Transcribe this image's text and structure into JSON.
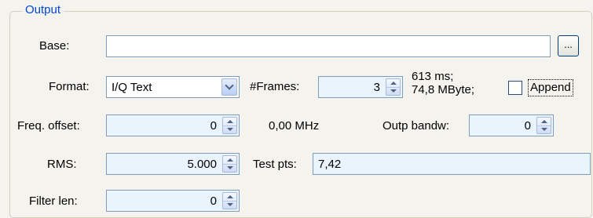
{
  "group": {
    "title": "Output"
  },
  "base": {
    "label": "Base:",
    "value": "",
    "browse_label": "..."
  },
  "format": {
    "label": "Format:",
    "value": "I/Q Text"
  },
  "frames": {
    "label": "#Frames:",
    "value": "3",
    "info_line1": "613 ms;",
    "info_line2": "74,8 MByte;"
  },
  "append": {
    "label": "Append",
    "checked": false
  },
  "freq_offset": {
    "label": "Freq. offset:",
    "value": "0",
    "display": "0,00 MHz"
  },
  "outp_bandw": {
    "label": "Outp bandw:",
    "value": "0"
  },
  "rms": {
    "label": "RMS:",
    "value": "5.000"
  },
  "test_pts": {
    "label": "Test pts:",
    "value": "7,42"
  },
  "filter_len": {
    "label": "Filter len:",
    "value": "0"
  },
  "icons": {
    "spin": "spin-updown-icon",
    "combo": "chevron-down-icon"
  },
  "colors": {
    "background": "#f4f3ee",
    "field": "#eaf4fd",
    "legend": "#0046d5",
    "border": "#7f9db9"
  }
}
